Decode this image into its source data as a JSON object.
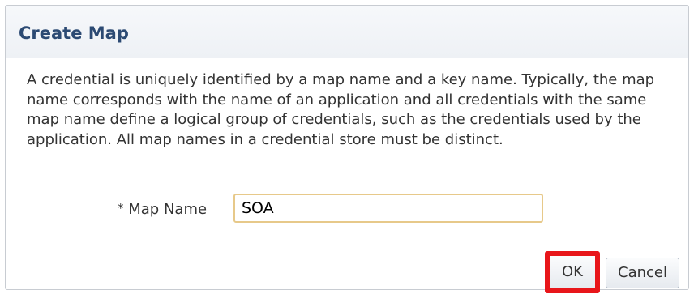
{
  "dialog": {
    "title": "Create Map",
    "description": "A credential is uniquely identified by a map name and a key name. Typically, the map name corresponds with the name of an application and all credentials with the same map name define a logical group of credentials, such as the credentials used by the application. All map names in a credential store must be distinct.",
    "map_name": {
      "required_marker": "*",
      "label": "Map Name",
      "value": "SOA"
    },
    "buttons": {
      "ok_label": "OK",
      "cancel_label": "Cancel"
    }
  },
  "colors": {
    "title": "#2c4a73",
    "input_border": "#e7c98a",
    "highlight": "#e8161a"
  }
}
